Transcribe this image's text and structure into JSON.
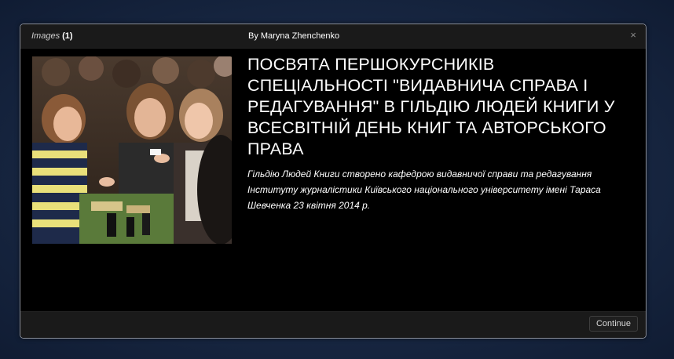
{
  "dialog": {
    "header": {
      "images_label": "Images",
      "images_count": "(1)",
      "author": "By Maryna Zhenchenko",
      "close_symbol": "×"
    },
    "photo_icon": "photo-crowd-image",
    "title": "ПОСВЯТА ПЕРШОКУРСНИКІВ СПЕЦІАЛЬНОСТІ \"ВИДАВНИЧА СПРАВА І РЕДАГУВАННЯ\" В ГІЛЬДІЮ ЛЮДЕЙ КНИГИ У ВСЕСВІТНІЙ ДЕНЬ КНИГ ТА АВТОРСЬКОГО ПРАВА",
    "description": "Гільдію Людей Книги створено кафедрою видавничої справи та редагування Інституту журналістики Київського національного університету імені Тараса Шевченка 23 квітня 2014 р.",
    "footer": {
      "continue_label": "Continue"
    }
  }
}
